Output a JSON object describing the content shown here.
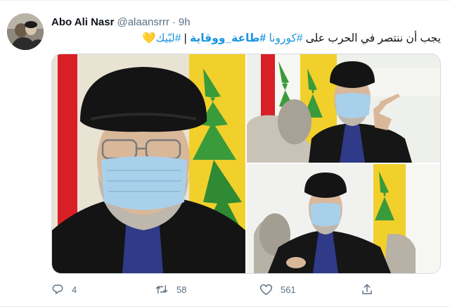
{
  "tweet": {
    "display_name": "Abo Ali Nasr",
    "handle": "@alaansrrr",
    "separator": "·",
    "time": "9h",
    "text": {
      "main": "يجب أن ننتصر في الحرب على ",
      "hashtag_1": "#كورونا",
      "hashtag_2": "#طاعة_ووقاية",
      "divider": " | ",
      "hashtag_3": "#لبّيك",
      "emoji": "💛"
    }
  },
  "actions": {
    "reply_count": "4",
    "retweet_count": "58",
    "like_count": "561"
  },
  "icons": {
    "reply": "reply-icon",
    "retweet": "retweet-icon",
    "like": "like-icon",
    "share": "share-icon"
  },
  "colors": {
    "link": "#1b95e0",
    "muted": "#5b7083",
    "text": "#0f1419",
    "flag_green": "#3a9b3a",
    "flag_yellow": "#f2d02c",
    "flag_red": "#d81f26"
  }
}
